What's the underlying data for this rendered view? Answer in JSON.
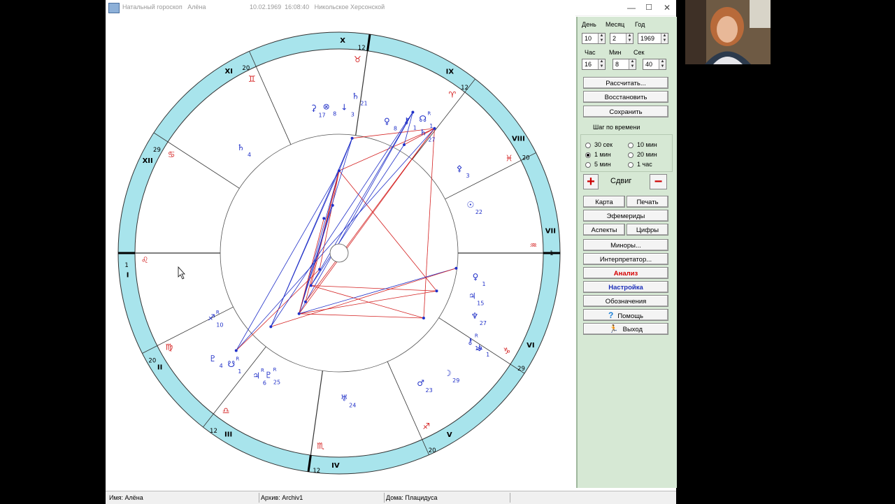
{
  "window": {
    "title_app": "Натальный гороскоп",
    "title_name": "Алёна",
    "title_date": "10.02.1969  16:08:40",
    "title_place": "Никольское Херсонской"
  },
  "panel": {
    "date_labels": [
      "День",
      "Месяц",
      "Год"
    ],
    "date_values": [
      "10",
      "2",
      "1969"
    ],
    "time_labels": [
      "Час",
      "Мин",
      "Сек"
    ],
    "time_values": [
      "16",
      "8",
      "40"
    ],
    "calc_button": "Рассчитать...",
    "restore_button": "Восстановить",
    "save_button": "Сохранить",
    "step_label": "Шаг по времени",
    "step_options": [
      "30 сек",
      "1 мин",
      "5 мин",
      "10 мин",
      "20 мин",
      "1 час"
    ],
    "step_selected": "1 мин",
    "shift_label": "Сдвиг",
    "plus_symbol": "+",
    "minus_symbol": "−",
    "map_button": "Карта",
    "print_button": "Печать",
    "ephem_button": "Эфемериды",
    "aspects_button": "Аспекты",
    "figures_button": "Цифры",
    "minors_button": "Миноры...",
    "interp_button": "Интерпретатор...",
    "analysis_button": "Анализ",
    "settings_button": "Настройка",
    "legend_button": "Обозначения",
    "help_button": "Помощь",
    "exit_button": "Выход",
    "help_icon": "question-icon",
    "exit_icon": "running-man-icon"
  },
  "status": {
    "name": "Имя:  Алёна",
    "archive": "Архив:  Archiv1",
    "houses": "Дома: Плацидуса"
  },
  "wheel": {
    "house_labels": [
      "I",
      "II",
      "III",
      "IV",
      "V",
      "VI",
      "VII",
      "VIII",
      "IX",
      "X",
      "XI",
      "XII"
    ],
    "house_degrees": [
      "1",
      "20",
      "12",
      "12",
      "20",
      "29",
      "1",
      "20",
      "12",
      "12",
      "20",
      "29"
    ],
    "sign_glyphs": [
      "♌",
      "♍",
      "♎",
      "♏",
      "♐",
      "♑",
      "♒",
      "♓",
      "♈",
      "♉",
      "♊",
      "♋"
    ],
    "planets": [
      {
        "glyph": "♀",
        "deg": "1"
      },
      {
        "glyph": "♃",
        "deg": "15"
      },
      {
        "glyph": "♆",
        "deg": "27"
      },
      {
        "glyph": "⚷",
        "deg": "19"
      },
      {
        "glyph": "⚶",
        "deg": "1"
      },
      {
        "glyph": "☽",
        "deg": "29"
      },
      {
        "glyph": "♂",
        "deg": "23"
      },
      {
        "glyph": "♅",
        "deg": "24"
      },
      {
        "glyph": "♇",
        "deg": "25"
      },
      {
        "glyph": "♃",
        "deg": "6"
      },
      {
        "glyph": "☋",
        "deg": "1"
      },
      {
        "glyph": "♇",
        "deg": "4"
      },
      {
        "glyph": "♐",
        "deg": "10"
      },
      {
        "glyph": "☉",
        "deg": "22"
      },
      {
        "glyph": "⚴",
        "deg": "3"
      },
      {
        "glyph": "♄",
        "deg": "27"
      },
      {
        "glyph": "♄",
        "deg": "4"
      },
      {
        "glyph": "⚳",
        "deg": "17"
      },
      {
        "glyph": "⊗",
        "deg": "8"
      },
      {
        "glyph": "↓",
        "deg": "3"
      },
      {
        "glyph": "♄",
        "deg": "21"
      },
      {
        "glyph": "♀",
        "deg": "8"
      },
      {
        "glyph": "⚷",
        "deg": "1"
      },
      {
        "glyph": "☊",
        "deg": "1"
      }
    ],
    "retro_mark": "R"
  },
  "colors": {
    "ring": "#a8e4ec",
    "aspect_red": "#d42020",
    "aspect_blue": "#2030c8",
    "sign_red": "#d42020",
    "panel_bg": "#d6e8d4"
  }
}
